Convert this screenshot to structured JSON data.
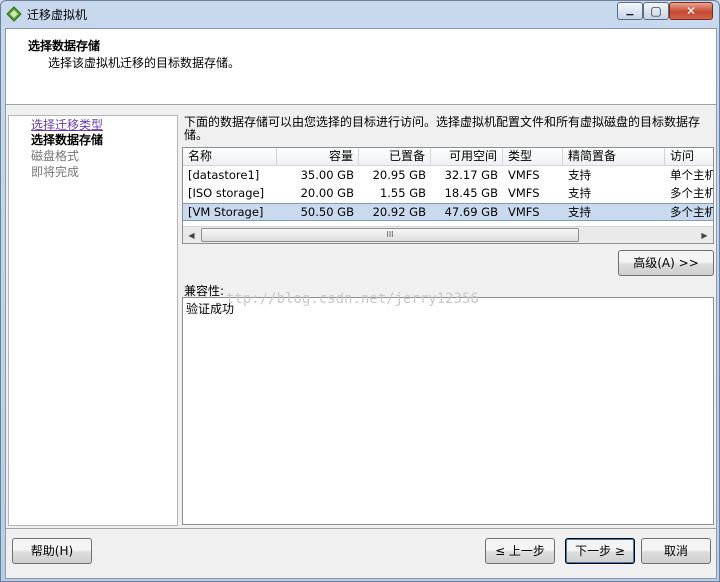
{
  "window": {
    "title": "迁移虚拟机",
    "min_glyph": "▁",
    "max_glyph": "▢",
    "close_glyph": "✕"
  },
  "header": {
    "title": "选择数据存储",
    "subtitle": "选择该虚拟机迁移的目标数据存储。"
  },
  "steps": [
    {
      "label": "选择迁移类型",
      "state": "link"
    },
    {
      "label": "选择数据存储",
      "state": "current"
    },
    {
      "label": "磁盘格式",
      "state": "future"
    },
    {
      "label": "即将完成",
      "state": "future"
    }
  ],
  "description": "下面的数据存储可以由您选择的目标进行访问。选择虚拟机配置文件和所有虚拟磁盘的目标数据存储。",
  "datastore_table": {
    "columns": [
      "名称",
      "容量",
      "已置备",
      "可用空间",
      "类型",
      "精简置备",
      "访问"
    ],
    "rows": [
      {
        "name": "[datastore1]",
        "capacity": "35.00 GB",
        "provisioned": "20.95 GB",
        "free": "32.17 GB",
        "type": "VMFS",
        "thin": "支持",
        "access": "单个主机"
      },
      {
        "name": "[ISO storage]",
        "capacity": "20.00 GB",
        "provisioned": "1.55 GB",
        "free": "18.45 GB",
        "type": "VMFS",
        "thin": "支持",
        "access": "多个主机"
      },
      {
        "name": "[VM Storage]",
        "capacity": "50.50 GB",
        "provisioned": "20.92 GB",
        "free": "47.69 GB",
        "type": "VMFS",
        "thin": "支持",
        "access": "多个主机"
      }
    ],
    "selected_row": 2,
    "scroll_left": "◀",
    "scroll_right": "▶",
    "thumb_grip": "III"
  },
  "advanced_button": "高级(A) >>",
  "compatibility": {
    "label": "兼容性:",
    "text": "验证成功"
  },
  "watermark": "ttp://blog.csdn.net/jerry12356",
  "footer": {
    "help": "帮助(H)",
    "back": "≤ 上一步",
    "next": "下一步 ≥",
    "cancel": "取消"
  },
  "colors": {
    "selection": "#c9d9ee",
    "link": "#6a3db0",
    "close_button": "#c44a31"
  }
}
